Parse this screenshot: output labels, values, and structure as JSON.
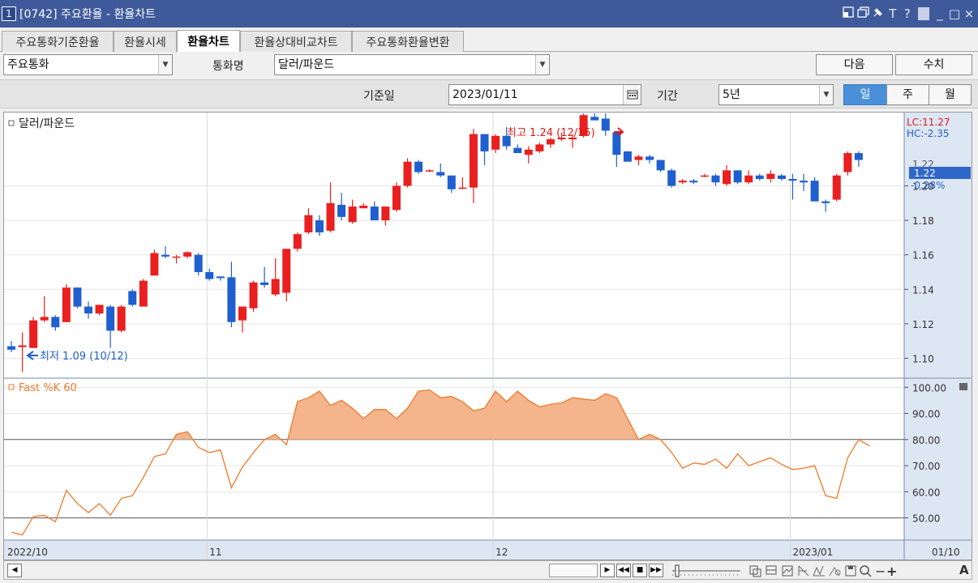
{
  "window": {
    "number": "1",
    "title": "[0742] 주요환율 - 환율차트",
    "icons": [
      "layout-icon",
      "restore-window-icon",
      "pin-icon",
      "font-icon",
      "help-icon",
      "minimize-icon",
      "maximize-icon",
      "close-icon"
    ],
    "icon_glyphs": {
      "font": "T",
      "help": "?",
      "minimize": "_",
      "maximize": "□",
      "close": "×"
    }
  },
  "tabs": [
    {
      "label": "주요통화기준환율",
      "active": false
    },
    {
      "label": "환율시세",
      "active": false
    },
    {
      "label": "환율차트",
      "active": true
    },
    {
      "label": "환율상대비교차트",
      "active": false
    },
    {
      "label": "주요통화환율변환",
      "active": false
    }
  ],
  "controls": {
    "category_select": "주요통화",
    "currency_label": "통화명",
    "currency_select": "달러/파운드",
    "next_button": "다음",
    "value_button": "수치",
    "base_date_label": "기준일",
    "base_date": "2023/01/11",
    "period_label": "기간",
    "period_select": "5년",
    "period_units": [
      {
        "label": "일",
        "active": true
      },
      {
        "label": "주",
        "active": false
      },
      {
        "label": "월",
        "active": false
      }
    ]
  },
  "colors": {
    "up": "#ea1f1f",
    "down": "#1f5fcf",
    "oscillator_line": "#f07a2a",
    "oscillator_fill": "#f4b48c",
    "axis_panel": "#dde6f3",
    "current_price_bg": "#2f66c9"
  },
  "chart_data": {
    "type": "candlestick",
    "series_label": "달러/파운드",
    "lc_label": "LC:11.27",
    "hc_label": "HC:-2.35",
    "high_annotation": "최고 1.24 (12/15)",
    "low_annotation": "최저 1.09 (10/12)",
    "current_price": "1.22",
    "current_change": "-0.28%",
    "price_axis_top_label": "1.22",
    "y_ticks": [
      "1.20",
      "1.18",
      "1.16",
      "1.14",
      "1.12",
      "1.10"
    ],
    "y_tick_values": [
      1.2,
      1.18,
      1.16,
      1.14,
      1.12,
      1.1
    ],
    "ylim": [
      1.0885,
      1.2425
    ],
    "x_labels": [
      {
        "text": "2022/10",
        "index": 0
      },
      {
        "text": "11",
        "index": 18
      },
      {
        "text": "12",
        "index": 44
      },
      {
        "text": "2023/01",
        "index": 71
      }
    ],
    "x_right_label": "01/10",
    "candles": [
      {
        "o": 1.107,
        "h": 1.11,
        "l": 1.1035,
        "c": 1.105
      },
      {
        "o": 1.1065,
        "h": 1.115,
        "l": 1.092,
        "c": 1.1075
      },
      {
        "o": 1.106,
        "h": 1.124,
        "l": 1.106,
        "c": 1.122
      },
      {
        "o": 1.122,
        "h": 1.136,
        "l": 1.121,
        "c": 1.124
      },
      {
        "o": 1.124,
        "h": 1.125,
        "l": 1.116,
        "c": 1.118
      },
      {
        "o": 1.121,
        "h": 1.143,
        "l": 1.121,
        "c": 1.141
      },
      {
        "o": 1.141,
        "h": 1.141,
        "l": 1.129,
        "c": 1.13
      },
      {
        "o": 1.13,
        "h": 1.133,
        "l": 1.123,
        "c": 1.126
      },
      {
        "o": 1.126,
        "h": 1.131,
        "l": 1.125,
        "c": 1.131
      },
      {
        "o": 1.13,
        "h": 1.131,
        "l": 1.106,
        "c": 1.116
      },
      {
        "o": 1.116,
        "h": 1.131,
        "l": 1.115,
        "c": 1.13
      },
      {
        "o": 1.139,
        "h": 1.14,
        "l": 1.13,
        "c": 1.131
      },
      {
        "o": 1.13,
        "h": 1.146,
        "l": 1.13,
        "c": 1.145
      },
      {
        "o": 1.148,
        "h": 1.163,
        "l": 1.148,
        "c": 1.161
      },
      {
        "o": 1.16,
        "h": 1.165,
        "l": 1.158,
        "c": 1.159
      },
      {
        "o": 1.159,
        "h": 1.16,
        "l": 1.155,
        "c": 1.159
      },
      {
        "o": 1.159,
        "h": 1.162,
        "l": 1.158,
        "c": 1.1615
      },
      {
        "o": 1.16,
        "h": 1.161,
        "l": 1.148,
        "c": 1.15
      },
      {
        "o": 1.15,
        "h": 1.152,
        "l": 1.145,
        "c": 1.146
      },
      {
        "o": 1.1475,
        "h": 1.1475,
        "l": 1.145,
        "c": 1.1465
      },
      {
        "o": 1.147,
        "h": 1.156,
        "l": 1.118,
        "c": 1.121
      },
      {
        "o": 1.122,
        "h": 1.13,
        "l": 1.115,
        "c": 1.13
      },
      {
        "o": 1.129,
        "h": 1.145,
        "l": 1.127,
        "c": 1.144
      },
      {
        "o": 1.144,
        "h": 1.153,
        "l": 1.141,
        "c": 1.1425
      },
      {
        "o": 1.137,
        "h": 1.158,
        "l": 1.136,
        "c": 1.146
      },
      {
        "o": 1.138,
        "h": 1.1625,
        "l": 1.133,
        "c": 1.1635
      },
      {
        "o": 1.1635,
        "h": 1.173,
        "l": 1.162,
        "c": 1.172
      },
      {
        "o": 1.173,
        "h": 1.187,
        "l": 1.172,
        "c": 1.183
      },
      {
        "o": 1.18,
        "h": 1.183,
        "l": 1.171,
        "c": 1.173
      },
      {
        "o": 1.174,
        "h": 1.202,
        "l": 1.173,
        "c": 1.19
      },
      {
        "o": 1.189,
        "h": 1.196,
        "l": 1.18,
        "c": 1.182
      },
      {
        "o": 1.179,
        "h": 1.192,
        "l": 1.178,
        "c": 1.188
      },
      {
        "o": 1.187,
        "h": 1.19,
        "l": 1.187,
        "c": 1.1885
      },
      {
        "o": 1.188,
        "h": 1.191,
        "l": 1.181,
        "c": 1.18
      },
      {
        "o": 1.18,
        "h": 1.188,
        "l": 1.177,
        "c": 1.188
      },
      {
        "o": 1.186,
        "h": 1.202,
        "l": 1.185,
        "c": 1.2
      },
      {
        "o": 1.2,
        "h": 1.216,
        "l": 1.199,
        "c": 1.214
      },
      {
        "o": 1.214,
        "h": 1.215,
        "l": 1.207,
        "c": 1.208
      },
      {
        "o": 1.2085,
        "h": 1.2095,
        "l": 1.208,
        "c": 1.209
      },
      {
        "o": 1.208,
        "h": 1.213,
        "l": 1.205,
        "c": 1.206
      },
      {
        "o": 1.206,
        "h": 1.206,
        "l": 1.196,
        "c": 1.198
      },
      {
        "o": 1.199,
        "h": 1.205,
        "l": 1.198,
        "c": 1.199
      },
      {
        "o": 1.199,
        "h": 1.233,
        "l": 1.19,
        "c": 1.23
      },
      {
        "o": 1.23,
        "h": 1.23,
        "l": 1.212,
        "c": 1.22
      },
      {
        "o": 1.221,
        "h": 1.23,
        "l": 1.219,
        "c": 1.229
      },
      {
        "o": 1.229,
        "h": 1.234,
        "l": 1.221,
        "c": 1.223
      },
      {
        "o": 1.222,
        "h": 1.224,
        "l": 1.219,
        "c": 1.219
      },
      {
        "o": 1.218,
        "h": 1.223,
        "l": 1.213,
        "c": 1.221
      },
      {
        "o": 1.22,
        "h": 1.225,
        "l": 1.219,
        "c": 1.224
      },
      {
        "o": 1.224,
        "h": 1.228,
        "l": 1.222,
        "c": 1.227
      },
      {
        "o": 1.227,
        "h": 1.231,
        "l": 1.226,
        "c": 1.228
      },
      {
        "o": 1.227,
        "h": 1.23,
        "l": 1.222,
        "c": 1.228
      },
      {
        "o": 1.229,
        "h": 1.242,
        "l": 1.228,
        "c": 1.241
      },
      {
        "o": 1.24,
        "h": 1.242,
        "l": 1.238,
        "c": 1.238
      },
      {
        "o": 1.239,
        "h": 1.242,
        "l": 1.229,
        "c": 1.232
      },
      {
        "o": 1.231,
        "h": 1.231,
        "l": 1.211,
        "c": 1.218
      },
      {
        "o": 1.22,
        "h": 1.22,
        "l": 1.214,
        "c": 1.214
      },
      {
        "o": 1.215,
        "h": 1.218,
        "l": 1.212,
        "c": 1.217
      },
      {
        "o": 1.217,
        "h": 1.218,
        "l": 1.213,
        "c": 1.215
      },
      {
        "o": 1.215,
        "h": 1.215,
        "l": 1.208,
        "c": 1.209
      },
      {
        "o": 1.209,
        "h": 1.21,
        "l": 1.199,
        "c": 1.2
      },
      {
        "o": 1.202,
        "h": 1.204,
        "l": 1.201,
        "c": 1.203
      },
      {
        "o": 1.203,
        "h": 1.204,
        "l": 1.201,
        "c": 1.202
      },
      {
        "o": 1.206,
        "h": 1.207,
        "l": 1.205,
        "c": 1.206
      },
      {
        "o": 1.206,
        "h": 1.207,
        "l": 1.2,
        "c": 1.202
      },
      {
        "o": 1.201,
        "h": 1.212,
        "l": 1.2,
        "c": 1.209
      },
      {
        "o": 1.209,
        "h": 1.209,
        "l": 1.201,
        "c": 1.202
      },
      {
        "o": 1.202,
        "h": 1.209,
        "l": 1.201,
        "c": 1.206
      },
      {
        "o": 1.206,
        "h": 1.207,
        "l": 1.203,
        "c": 1.204
      },
      {
        "o": 1.204,
        "h": 1.209,
        "l": 1.202,
        "c": 1.207
      },
      {
        "o": 1.206,
        "h": 1.207,
        "l": 1.203,
        "c": 1.204
      },
      {
        "o": 1.204,
        "h": 1.207,
        "l": 1.192,
        "c": 1.203
      },
      {
        "o": 1.203,
        "h": 1.207,
        "l": 1.197,
        "c": 1.202
      },
      {
        "o": 1.203,
        "h": 1.205,
        "l": 1.191,
        "c": 1.191
      },
      {
        "o": 1.191,
        "h": 1.192,
        "l": 1.185,
        "c": 1.19
      },
      {
        "o": 1.192,
        "h": 1.207,
        "l": 1.191,
        "c": 1.206
      },
      {
        "o": 1.208,
        "h": 1.22,
        "l": 1.206,
        "c": 1.219
      },
      {
        "o": 1.219,
        "h": 1.22,
        "l": 1.211,
        "c": 1.215
      }
    ],
    "oscillator": {
      "label": "Fast %K 60",
      "threshold_high": 80,
      "threshold_low": 50,
      "ylim": [
        41.5,
        103.5
      ],
      "y_ticks": [
        "100.00",
        "90.00",
        "80.00",
        "70.00",
        "60.00",
        "50.00"
      ],
      "y_tick_values": [
        100,
        90,
        80,
        70,
        60,
        50
      ],
      "values": [
        44.5,
        43.5,
        50.5,
        51.0,
        48.5,
        60.5,
        55.5,
        52.0,
        55.5,
        51.0,
        57.5,
        58.5,
        65.5,
        73.5,
        74.5,
        82.0,
        83.0,
        77.0,
        75.0,
        76.0,
        61.5,
        69.5,
        75.0,
        80.0,
        82.0,
        78.0,
        94.5,
        96.0,
        98.5,
        93.0,
        95.0,
        92.0,
        88.0,
        91.5,
        91.5,
        88.0,
        92.0,
        98.5,
        99.0,
        96.0,
        96.5,
        94.5,
        91.0,
        92.0,
        98.5,
        94.5,
        98.5,
        95.0,
        92.5,
        93.5,
        94.0,
        96.0,
        95.5,
        95.0,
        97.5,
        96.0,
        88.0,
        80.0,
        82.0,
        80.0,
        75.0,
        69.0,
        71.0,
        70.5,
        72.5,
        69.0,
        74.5,
        70.0,
        71.5,
        73.0,
        70.5,
        68.5,
        69.0,
        70.0,
        58.5,
        57.5,
        73.0,
        80.0,
        77.5
      ]
    }
  },
  "toolbar": {
    "glyphs": {
      "next": "▶",
      "prev": "◀◀",
      "stop": "■",
      "play": "▶▶",
      "scroll_left": "◀",
      "minus": "−",
      "plus": "+",
      "auto": "A"
    }
  }
}
